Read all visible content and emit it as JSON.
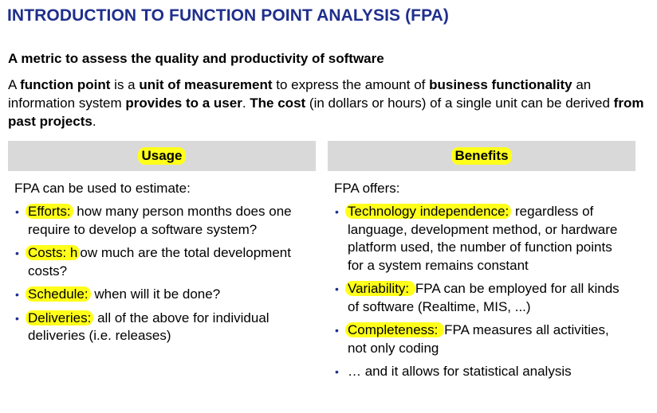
{
  "title": "INTRODUCTION TO FUNCTION POINT ANALYSIS (FPA)",
  "subtitle": "A metric to assess the quality and productivity of software",
  "intro": {
    "p1": "A ",
    "b1": "function point",
    "p2": " is a ",
    "b2": "unit of measurement",
    "p3": " to express the amount of ",
    "b3": "business functionality",
    "p4": " an information system ",
    "b4": "provides to a user",
    "p5": ". ",
    "b5": "The cost",
    "p6": " (in dollars or hours) of a single unit can be derived ",
    "b6": "from past projects",
    "p7": "."
  },
  "usage": {
    "header": "Usage",
    "intro": "FPA can be used to estimate:",
    "items": [
      {
        "term": "Efforts:",
        "text": " how many person months does one require to develop a software system?"
      },
      {
        "term": "Costs: h",
        "text": "ow much are the total development costs?"
      },
      {
        "term": "Schedule:",
        "text": " when will it be done?"
      },
      {
        "term": "Deliveries:",
        "text": " all of the above for individual deliveries (i.e. releases)"
      }
    ]
  },
  "benefits": {
    "header": "Benefits",
    "intro": "FPA offers:",
    "items": [
      {
        "term": "Technology independence:",
        "text": " regardless of language, development method, or hardware platform used, the number of function points for a system remains constant"
      },
      {
        "term": "Variability: ",
        "text": "FPA can be employed for all kinds of software (Realtime, MIS, ...)"
      },
      {
        "term": "Completeness: ",
        "text": "FPA measures all activities, not only coding"
      },
      {
        "term": "",
        "text": "… and it allows for statistical analysis"
      }
    ]
  },
  "bullet_glyph": "•",
  "colors": {
    "title": "#1f2f8c",
    "highlight": "#ffff1a",
    "header_bg": "#d9d9d9"
  }
}
